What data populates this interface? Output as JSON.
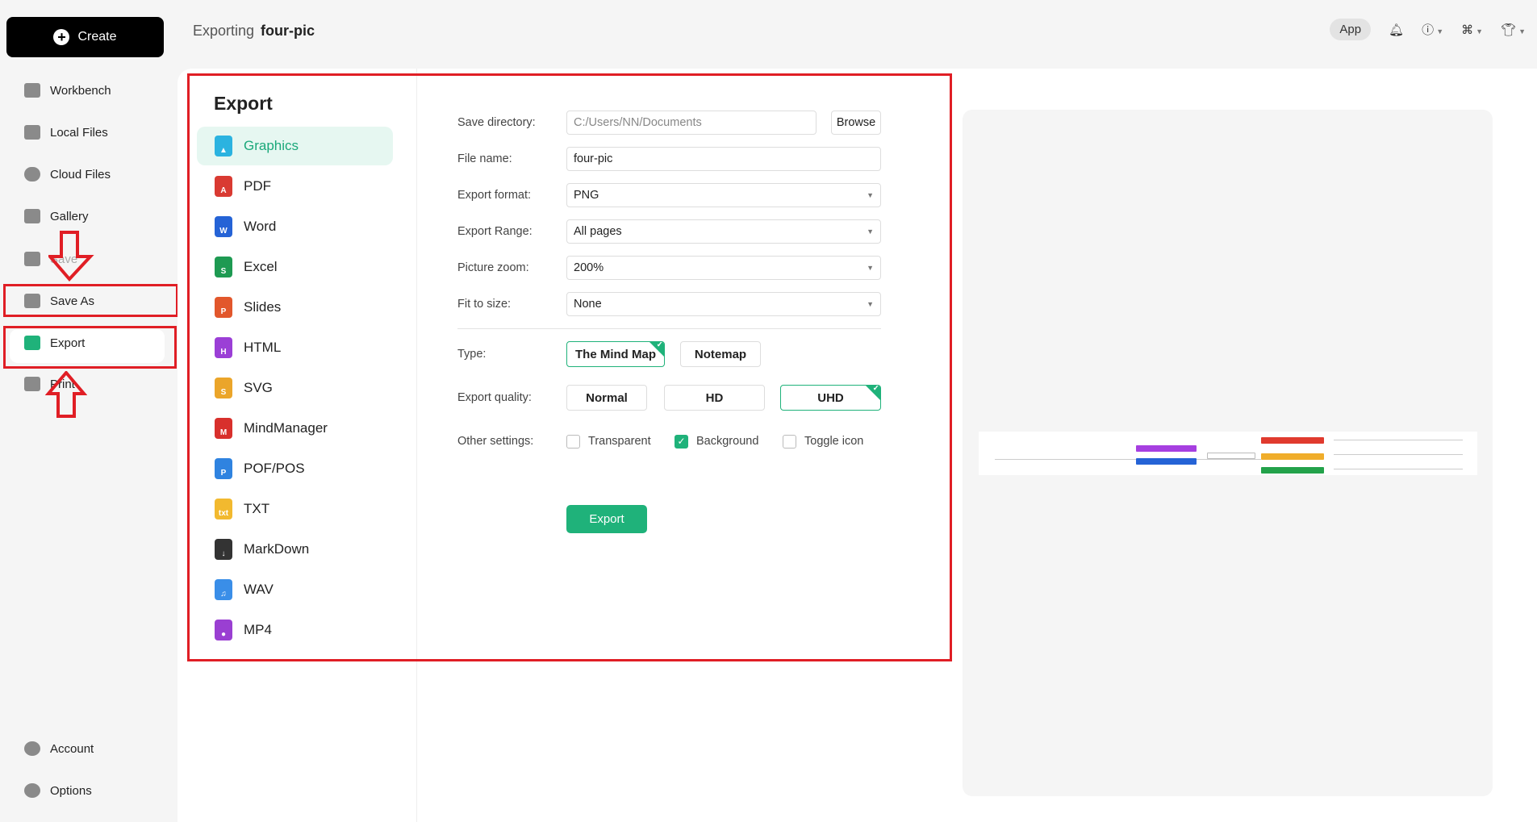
{
  "sidebar": {
    "create_label": "Create",
    "items": [
      {
        "label": "Workbench",
        "icon": "workbench-icon"
      },
      {
        "label": "Local Files",
        "icon": "folder-icon"
      },
      {
        "label": "Cloud Files",
        "icon": "cloud-icon"
      },
      {
        "label": "Gallery",
        "icon": "gallery-icon"
      },
      {
        "label": "Save",
        "icon": "save-icon"
      },
      {
        "label": "Save As",
        "icon": "save-as-icon"
      },
      {
        "label": "Export",
        "icon": "export-icon"
      },
      {
        "label": "Print",
        "icon": "print-icon"
      }
    ],
    "bottom": [
      {
        "label": "Account",
        "icon": "account-icon"
      },
      {
        "label": "Options",
        "icon": "gear-icon"
      }
    ]
  },
  "header": {
    "prefix": "Exporting",
    "filename": "four-pic",
    "app_label": "App"
  },
  "export": {
    "title": "Export",
    "formats": [
      {
        "label": "Graphics",
        "color": "#2bb3e0",
        "glyph": "▲"
      },
      {
        "label": "PDF",
        "color": "#d93a32",
        "glyph": "A"
      },
      {
        "label": "Word",
        "color": "#2563d6",
        "glyph": "W"
      },
      {
        "label": "Excel",
        "color": "#1e9a52",
        "glyph": "S"
      },
      {
        "label": "Slides",
        "color": "#e2572c",
        "glyph": "P"
      },
      {
        "label": "HTML",
        "color": "#9b3fd6",
        "glyph": "H"
      },
      {
        "label": "SVG",
        "color": "#eba52a",
        "glyph": "S"
      },
      {
        "label": "MindManager",
        "color": "#d8302c",
        "glyph": "M"
      },
      {
        "label": "POF/POS",
        "color": "#2f83e0",
        "glyph": "P"
      },
      {
        "label": "TXT",
        "color": "#f2b92f",
        "glyph": "txt"
      },
      {
        "label": "MarkDown",
        "color": "#333333",
        "glyph": "↓"
      },
      {
        "label": "WAV",
        "color": "#3a8ee8",
        "glyph": "♫"
      },
      {
        "label": "MP4",
        "color": "#9a3fd2",
        "glyph": "●"
      }
    ],
    "selected": "Graphics"
  },
  "form": {
    "save_directory": {
      "label": "Save directory:",
      "value": "C:/Users/NN/Documents",
      "browse": "Browse"
    },
    "file_name": {
      "label": "File name:",
      "value": "four-pic"
    },
    "export_format": {
      "label": "Export format:",
      "value": "PNG"
    },
    "export_range": {
      "label": "Export Range:",
      "value": "All pages"
    },
    "picture_zoom": {
      "label": "Picture zoom:",
      "value": "200%"
    },
    "fit_to_size": {
      "label": "Fit to size:",
      "value": "None"
    },
    "type": {
      "label": "Type:",
      "options": [
        "The Mind Map",
        "Notemap"
      ],
      "selected": "The Mind Map"
    },
    "quality": {
      "label": "Export quality:",
      "options": [
        "Normal",
        "HD",
        "UHD"
      ],
      "selected": "UHD"
    },
    "other": {
      "label": "Other settings:",
      "transparent": {
        "label": "Transparent",
        "checked": false
      },
      "background": {
        "label": "Background",
        "checked": true
      },
      "toggle_icon": {
        "label": "Toggle icon",
        "checked": false
      }
    },
    "export_button": "Export"
  },
  "colors": {
    "accent": "#1fb27a",
    "highlight": "#e01e25"
  }
}
